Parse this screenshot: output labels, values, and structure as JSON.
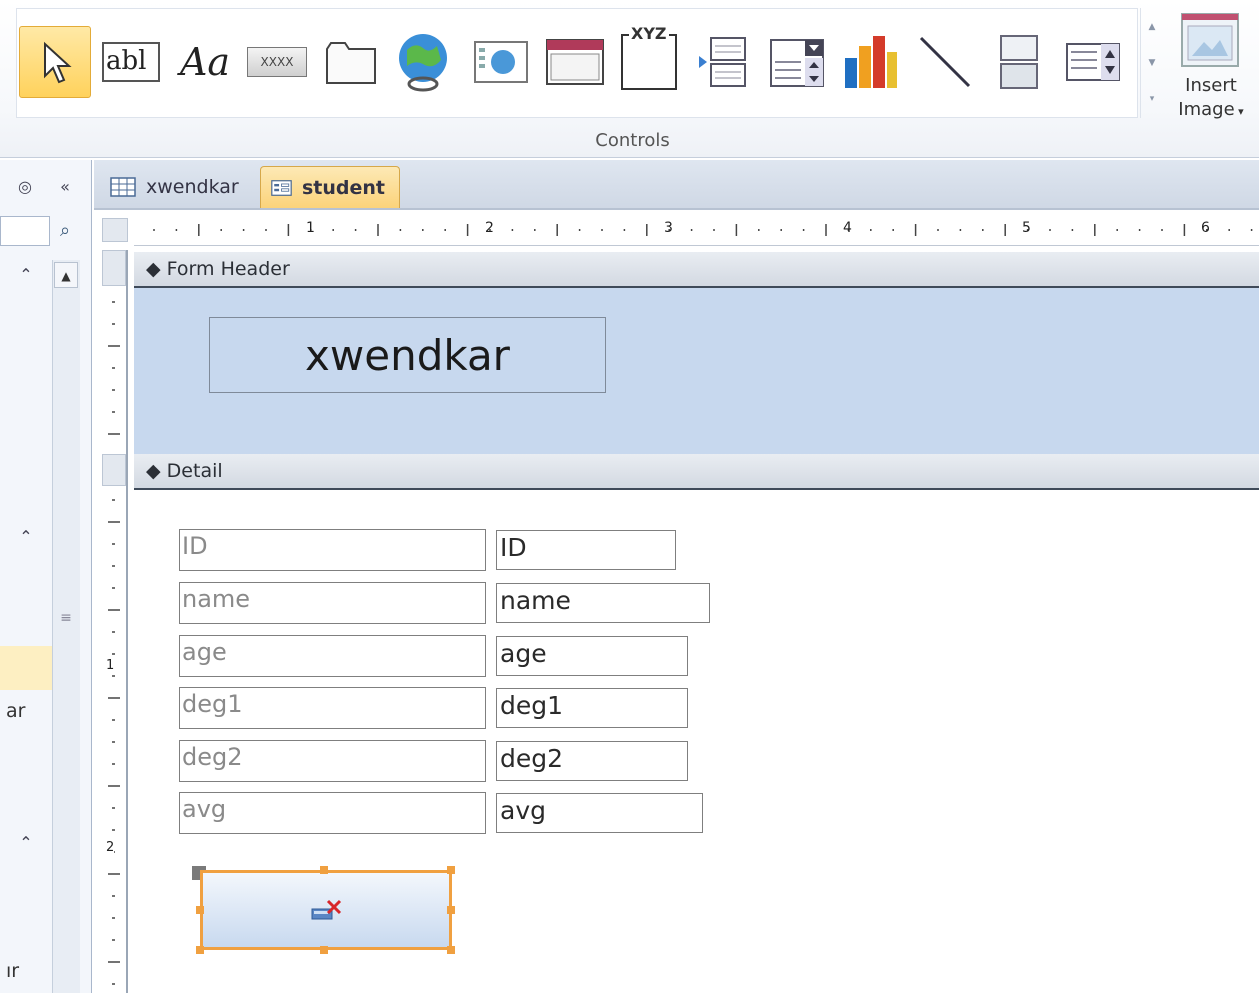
{
  "ribbon": {
    "group_label": "Controls",
    "insert_image": {
      "line1": "Insert",
      "line2": "Image"
    },
    "controls": [
      {
        "name": "select-icon"
      },
      {
        "name": "textbox-icon",
        "text": "abl"
      },
      {
        "name": "label-icon",
        "text": "Aa"
      },
      {
        "name": "button-icon",
        "text": "XXXX"
      },
      {
        "name": "tab-control-icon"
      },
      {
        "name": "hyperlink-icon"
      },
      {
        "name": "web-browser-icon"
      },
      {
        "name": "navigation-control-icon"
      },
      {
        "name": "option-group-icon",
        "text": "XYZ"
      },
      {
        "name": "page-break-icon"
      },
      {
        "name": "combo-box-icon"
      },
      {
        "name": "chart-icon"
      },
      {
        "name": "line-icon"
      },
      {
        "name": "toggle-button-icon"
      },
      {
        "name": "list-box-icon"
      }
    ]
  },
  "nav": {
    "item_partial_1": "ar",
    "item_partial_2": "ır"
  },
  "tabs": {
    "tab1": "xwendkar",
    "tab2": "student"
  },
  "ruler": {
    "marks": [
      "1",
      "2",
      "3",
      "4",
      "5",
      "6"
    ],
    "vmarks": [
      "1",
      "2"
    ]
  },
  "form": {
    "header_label": "Form Header",
    "detail_label": "Detail",
    "title": "xwendkar",
    "labels": [
      "ID",
      "name",
      "age",
      "deg1",
      "deg2",
      "avg"
    ],
    "fields": [
      "ID",
      "name",
      "age",
      "deg1",
      "deg2",
      "avg"
    ]
  },
  "colors": {
    "header_bg": "#c7d8ee",
    "selected_border": "#f0a040",
    "active_tab": "#fbd37a"
  }
}
